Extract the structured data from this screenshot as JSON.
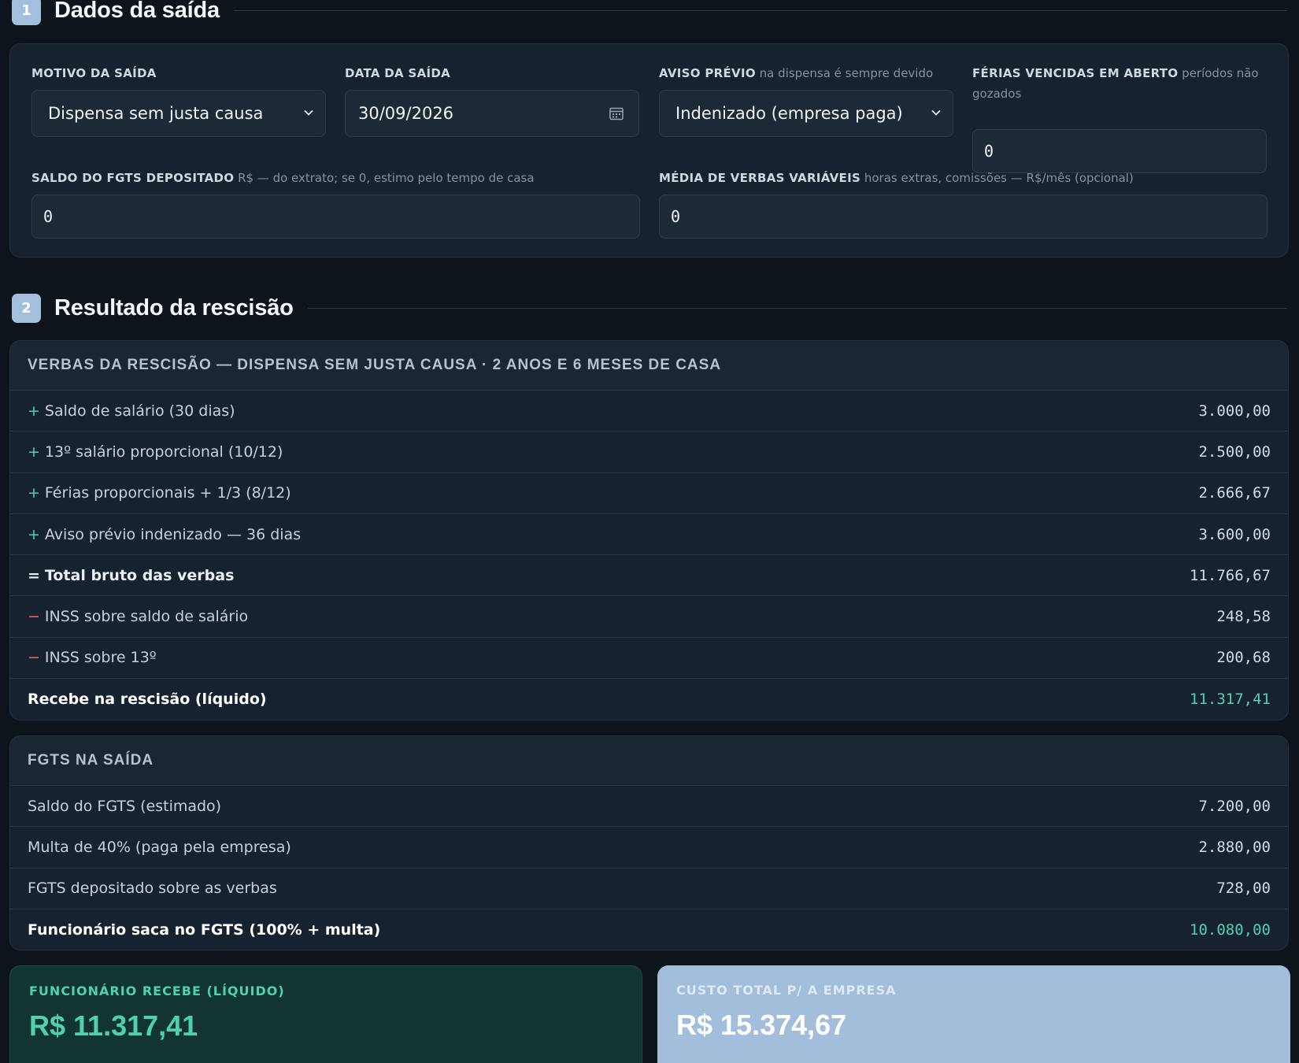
{
  "section1": {
    "number": "1",
    "title": "Dados da saída"
  },
  "form": {
    "motivo": {
      "label": "MOTIVO DA SAÍDA",
      "value": "Dispensa sem justa causa"
    },
    "data": {
      "label": "DATA DA SAÍDA",
      "value": "30/09/2026"
    },
    "aviso": {
      "label": "AVISO PRÉVIO",
      "hint": "na dispensa é sempre devido",
      "value": "Indenizado (empresa paga)"
    },
    "ferias": {
      "label": "FÉRIAS VENCIDAS EM ABERTO",
      "hint": "períodos não gozados",
      "value": "0"
    },
    "fgts": {
      "label": "SALDO DO FGTS DEPOSITADO",
      "hint": "R$ — do extrato; se 0, estimo pelo tempo de casa",
      "value": "0"
    },
    "media": {
      "label": "MÉDIA DE VERBAS VARIÁVEIS",
      "hint": "horas extras, comissões — R$/mês (opcional)",
      "value": "0"
    }
  },
  "section2": {
    "number": "2",
    "title": "Resultado da rescisão"
  },
  "verbas": {
    "title": "VERBAS DA RESCISÃO — DISPENSA SEM JUSTA CAUSA · 2 ANOS E 6 MESES DE CASA",
    "rows": [
      {
        "sign": "+",
        "label": "Saldo de salário (30 dias)",
        "value": "3.000,00"
      },
      {
        "sign": "+",
        "label": "13º salário proporcional (10/12)",
        "value": "2.500,00"
      },
      {
        "sign": "+",
        "label": "Férias proporcionais + 1/3 (8/12)",
        "value": "2.666,67"
      },
      {
        "sign": "+",
        "label": "Aviso prévio indenizado — 36 dias",
        "value": "3.600,00"
      },
      {
        "sign": "=",
        "label": "Total bruto das verbas",
        "value": "11.766,67"
      },
      {
        "sign": "−",
        "label": "INSS sobre saldo de salário",
        "value": "248,58"
      },
      {
        "sign": "−",
        "label": "INSS sobre 13º",
        "value": "200,68"
      },
      {
        "sign": "",
        "label": "Recebe na rescisão (líquido)",
        "value": "11.317,41"
      }
    ]
  },
  "fgts_table": {
    "title": "FGTS NA SAÍDA",
    "rows": [
      {
        "label": "Saldo do FGTS (estimado)",
        "value": "7.200,00"
      },
      {
        "label": "Multa de 40% (paga pela empresa)",
        "value": "2.880,00"
      },
      {
        "label": "FGTS depositado sobre as verbas",
        "value": "728,00"
      },
      {
        "label": "Funcionário saca no FGTS (100% + multa)",
        "value": "10.080,00"
      }
    ]
  },
  "summary": {
    "employee": {
      "label": "FUNCIONÁRIO RECEBE (LÍQUIDO)",
      "value": "R$ 11.317,41"
    },
    "company": {
      "label": "CUSTO TOTAL P/ A EMPRESA",
      "value": "R$ 15.374,67"
    }
  },
  "colors": {
    "accent_green": "#4fd1b0",
    "accent_red": "#f0645a",
    "badge_blue": "#a3bfdd"
  }
}
